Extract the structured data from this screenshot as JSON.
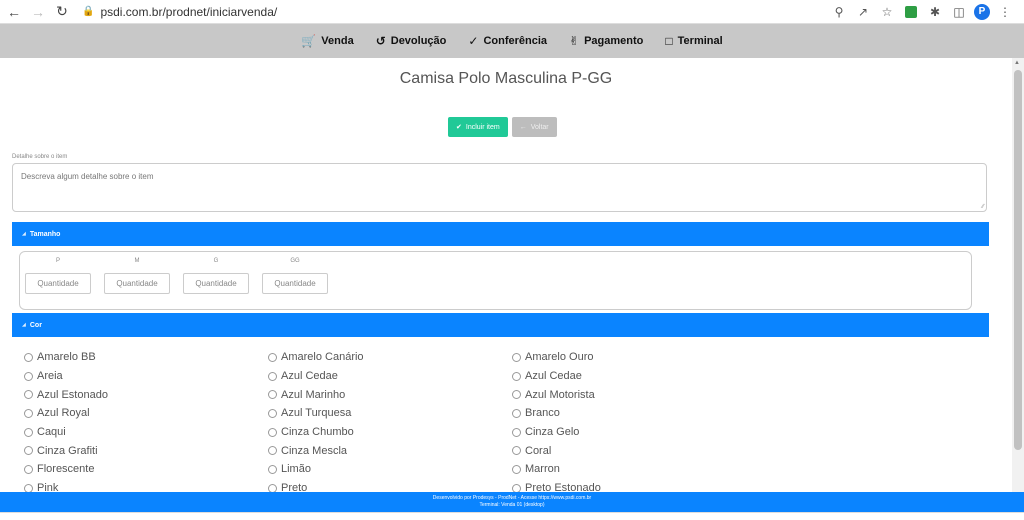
{
  "browser": {
    "url": "psdi.com.br/prodnet/iniciarvenda/",
    "profile_initial": "P"
  },
  "nav": {
    "items": [
      {
        "label": "Venda",
        "icon": "cart-icon"
      },
      {
        "label": "Devolução",
        "icon": "undo-icon"
      },
      {
        "label": "Conferência",
        "icon": "check-circle-icon"
      },
      {
        "label": "Pagamento",
        "icon": "hand-money-icon"
      },
      {
        "label": "Terminal",
        "icon": "monitor-icon"
      }
    ]
  },
  "product": {
    "title": "Camisa Polo Masculina P-GG"
  },
  "actions": {
    "include_label": "Incluir item",
    "back_label": "Voltar"
  },
  "detail": {
    "label": "Detalhe sobre o item",
    "placeholder": "Descreva algum detalhe sobre o item"
  },
  "size_section": {
    "title": "Tamanho",
    "sizes": [
      {
        "label": "P",
        "placeholder": "Quantidade"
      },
      {
        "label": "M",
        "placeholder": "Quantidade"
      },
      {
        "label": "G",
        "placeholder": "Quantidade"
      },
      {
        "label": "GG",
        "placeholder": "Quantidade"
      }
    ]
  },
  "color_section": {
    "title": "Cor",
    "rows": [
      [
        "Amarelo BB",
        "Amarelo Canário",
        "Amarelo Ouro"
      ],
      [
        "Areia",
        "Azul Cedae",
        "Azul Cedae"
      ],
      [
        "Azul Estonado",
        "Azul Marinho",
        "Azul Motorista"
      ],
      [
        "Azul Royal",
        "Azul Turquesa",
        "Branco"
      ],
      [
        "Caqui",
        "Cinza Chumbo",
        "Cinza Gelo"
      ],
      [
        "Cinza Grafiti",
        "Cinza Mescla",
        "Coral"
      ],
      [
        "Florescente",
        "Limão",
        "Marron"
      ],
      [
        "Pink",
        "Preto",
        "Preto Estonado"
      ]
    ]
  },
  "footer": {
    "line1": "Desenvolvido por Prodesys - ProdNet - Acesse https://www.psdi.com.br",
    "line2": "Terminal: Venda 01 (desktop)"
  },
  "colors": {
    "accent_blue": "#0a84ff",
    "primary_green": "#20c997",
    "nav_gray": "#c8c8c8"
  }
}
